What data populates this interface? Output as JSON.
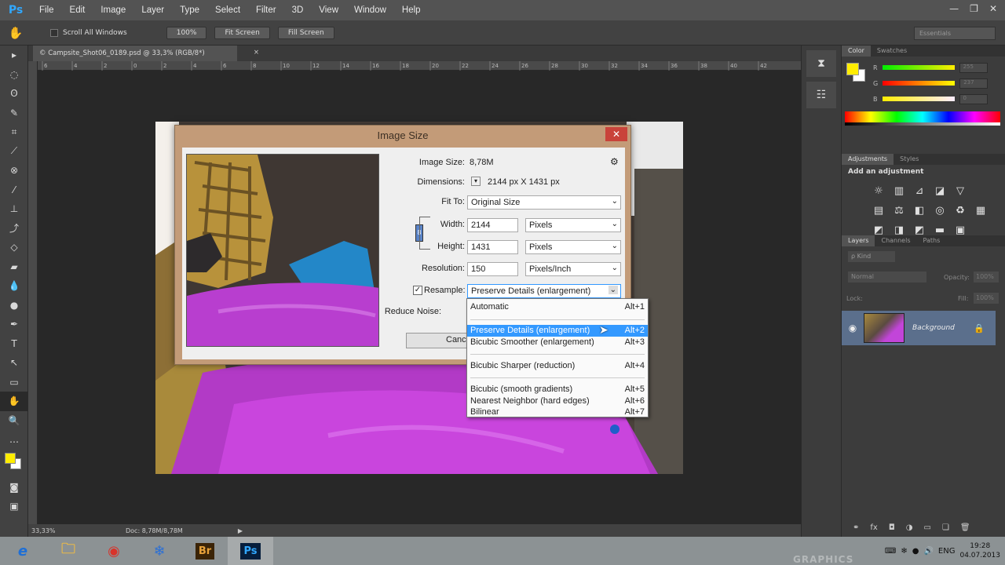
{
  "app": {
    "logo": "Ps"
  },
  "menu": [
    "File",
    "Edit",
    "Image",
    "Layer",
    "Type",
    "Select",
    "Filter",
    "3D",
    "View",
    "Window",
    "Help"
  ],
  "window_controls": {
    "minimize": "—",
    "restore": "❐",
    "close": "✕"
  },
  "options": {
    "scroll_all_label": "Scroll All Windows",
    "zoom_label": "100%",
    "fit_screen": "Fit Screen",
    "fill_screen": "Fill Screen",
    "workspace": "Essentials"
  },
  "document": {
    "tab_title": "© Campsite_Shot06_0189.psd @ 33,3% (RGB/8*)",
    "tab_close": "×",
    "zoom": "33,33%",
    "doc_info": "Doc: 8,78M/8,78M"
  },
  "ruler_marks": [
    "6",
    "4",
    "2",
    "0",
    "2",
    "4",
    "6",
    "8",
    "10",
    "12",
    "14",
    "16",
    "18",
    "20",
    "22",
    "24",
    "26",
    "28",
    "30",
    "32",
    "34",
    "36",
    "38",
    "40",
    "42"
  ],
  "panels": {
    "color_tabs": [
      "Color",
      "Swatches"
    ],
    "sliders": [
      {
        "label": "R",
        "value": "255"
      },
      {
        "label": "G",
        "value": "237"
      },
      {
        "label": "B",
        "value": "0"
      }
    ],
    "adjustments_tabs": [
      "Adjustments",
      "Styles"
    ],
    "add_adjustment": "Add an adjustment",
    "layers_tabs": [
      "Layers",
      "Channels",
      "Paths"
    ],
    "kind_label": "ρ Kind",
    "blend_mode": "Normal",
    "opacity_label": "Opacity:",
    "opacity_value": "100%",
    "lock_label": "Lock:",
    "fill_label": "Fill:",
    "fill_value": "100%",
    "layer_name": "Background"
  },
  "dialog": {
    "title": "Image Size",
    "close": "✕",
    "image_size_label": "Image Size:",
    "image_size_value": "8,78M",
    "dimensions_label": "Dimensions:",
    "dimensions_value": "2144 px  X  1431 px",
    "fit_to_label": "Fit To:",
    "fit_to_value": "Original Size",
    "width_label": "Width:",
    "width_value": "2144",
    "width_unit": "Pixels",
    "height_label": "Height:",
    "height_value": "1431",
    "height_unit": "Pixels",
    "resolution_label": "Resolution:",
    "resolution_value": "150",
    "resolution_unit": "Pixels/Inch",
    "resample_label": "Resample:",
    "resample_value": "Preserve Details (enlargement)",
    "reduce_noise_label": "Reduce Noise:",
    "cancel_label": "Cance"
  },
  "resample_options": [
    {
      "label": "Automatic",
      "shortcut": "Alt+1"
    },
    {
      "label": "Preserve Details (enlargement)",
      "shortcut": "Alt+2"
    },
    {
      "label": "Bicubic Smoother (enlargement)",
      "shortcut": "Alt+3"
    },
    {
      "label": "Bicubic Sharper (reduction)",
      "shortcut": "Alt+4"
    },
    {
      "label": "Bicubic (smooth gradients)",
      "shortcut": "Alt+5"
    },
    {
      "label": "Nearest Neighbor (hard edges)",
      "shortcut": "Alt+6"
    },
    {
      "label": "Bilinear",
      "shortcut": "Alt+7"
    }
  ],
  "taskbar": {
    "apps": [
      "e",
      "🗀",
      "◉",
      "❄",
      "Br",
      "Ps"
    ],
    "lang": "ENG",
    "time": "19:28",
    "date": "04.07.2013"
  },
  "watermark": "GRAPHICS",
  "colors": {
    "foreground": "#ffed00",
    "background": "#ffffff",
    "accent": "#3399ff"
  }
}
